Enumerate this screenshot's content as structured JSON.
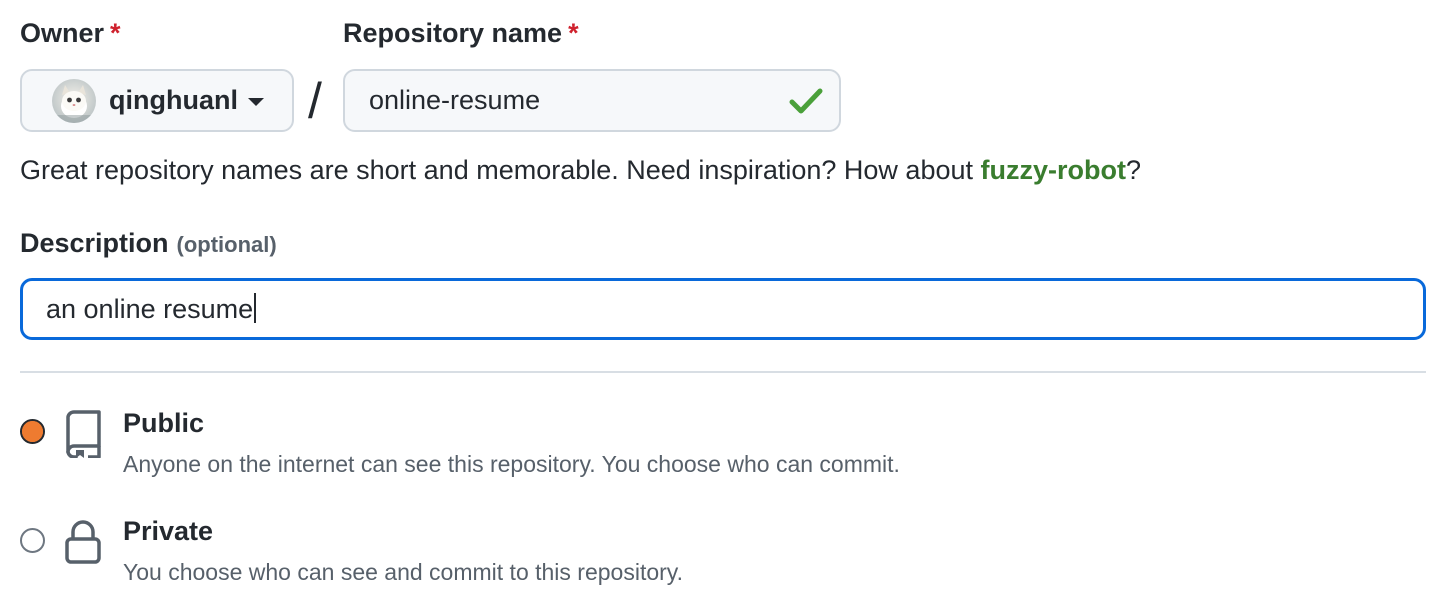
{
  "owner": {
    "label": "Owner",
    "required_mark": "*",
    "selected": "qinghuanl",
    "icons": {
      "avatar": "user-avatar-cat",
      "caret": "caret-down-icon"
    }
  },
  "separator": "/",
  "repository": {
    "label": "Repository name",
    "required_mark": "*",
    "value": "online-resume",
    "status_icon": "check-icon"
  },
  "hint": {
    "text_before": "Great repository names are short and memorable. Need inspiration? How about ",
    "suggestion": "fuzzy-robot",
    "text_after": "?"
  },
  "description": {
    "label": "Description",
    "optional_label": "(optional)",
    "value": "an online resume"
  },
  "visibility": {
    "options": [
      {
        "title": "Public",
        "description": "Anyone on the internet can see this repository. You choose who can commit.",
        "icon": "repo-icon",
        "selected": true
      },
      {
        "title": "Private",
        "description": "You choose who can see and commit to this repository.",
        "icon": "lock-icon",
        "selected": false
      }
    ]
  },
  "colors": {
    "required": "#cf222e",
    "suggestion": "#3a7d2f",
    "focus_border": "#0969da",
    "check": "#2da44e",
    "radio_selected": "#ee7b30"
  }
}
